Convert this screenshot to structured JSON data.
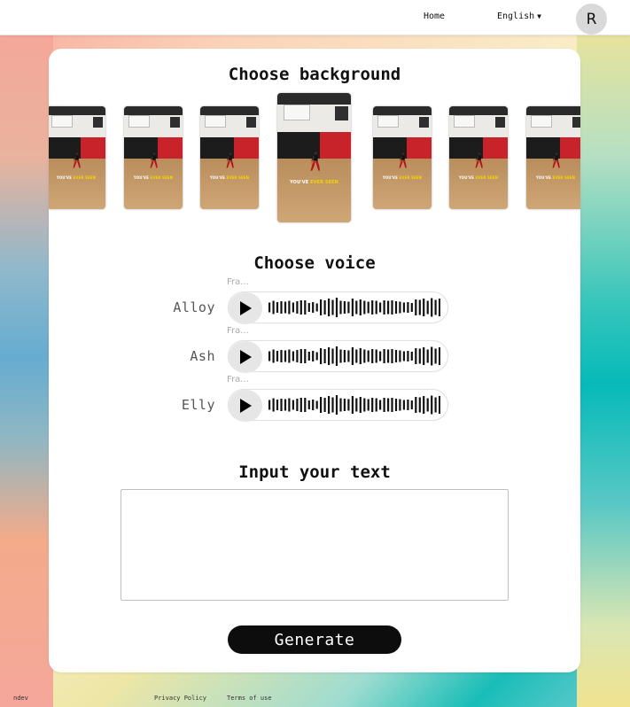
{
  "header": {
    "home_label": "Home",
    "language_label": "English",
    "avatar_initial": "R"
  },
  "background_section": {
    "title": "Choose background",
    "thumbnails": [
      {
        "caption_a": "YOU'VE ",
        "caption_b": "EVER SEEN",
        "selected": false
      },
      {
        "caption_a": "YOU'VE ",
        "caption_b": "EVER SEEN",
        "selected": false
      },
      {
        "caption_a": "YOU'VE ",
        "caption_b": "EVER SEEN",
        "selected": false
      },
      {
        "caption_a": "YOU'VE ",
        "caption_b": "EVER SEEN",
        "selected": true
      },
      {
        "caption_a": "YOU'VE ",
        "caption_b": "EVER SEEN",
        "selected": false
      },
      {
        "caption_a": "YOU'VE ",
        "caption_b": "EVER SEEN",
        "selected": false
      },
      {
        "caption_a": "YOU'VE ",
        "caption_b": "EVER SEEN",
        "selected": false
      }
    ]
  },
  "voice_section": {
    "title": "Choose voice",
    "voices": [
      {
        "name": "Alloy",
        "subtitle": "Fra..."
      },
      {
        "name": "Ash",
        "subtitle": "Fra..."
      },
      {
        "name": "Elly",
        "subtitle": "Fra..."
      }
    ]
  },
  "text_section": {
    "title": "Input your text",
    "value": "",
    "placeholder": ""
  },
  "generate_label": "Generate",
  "footer": {
    "brand": "ndev",
    "privacy": "Privacy Policy",
    "terms": "Terms of use"
  }
}
